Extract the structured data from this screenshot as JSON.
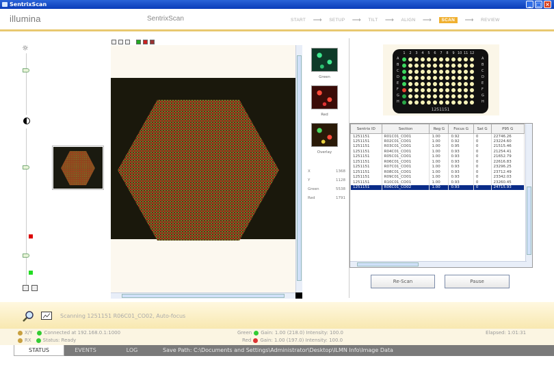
{
  "window": {
    "title": "SentrixScan",
    "min": "_",
    "max": "□",
    "close": "×"
  },
  "header": {
    "logo": "illumina",
    "app_name": "SentrixScan",
    "steps": [
      "START",
      "SETUP",
      "TILT",
      "ALIGN",
      "SCAN",
      "REVIEW"
    ],
    "active_step": "SCAN"
  },
  "colors": {
    "accent": "#f0b030",
    "selection": "#0a2c88",
    "green_led": "#3c3",
    "red_led": "#d33"
  },
  "channels": [
    {
      "label": "Green"
    },
    {
      "label": "Red"
    },
    {
      "label": "Overlay"
    }
  ],
  "readouts": [
    {
      "label": "X",
      "value": "1368"
    },
    {
      "label": "Y",
      "value": "1128"
    },
    {
      "label": "Green",
      "value": "5538"
    },
    {
      "label": "Red",
      "value": "1791"
    }
  ],
  "plate": {
    "rows": [
      "A",
      "B",
      "C",
      "D",
      "E",
      "F",
      "G",
      "H"
    ],
    "cols": [
      "1",
      "2",
      "3",
      "4",
      "5",
      "6",
      "7",
      "8",
      "9",
      "10",
      "11",
      "12"
    ],
    "barcode": "1251151"
  },
  "table": {
    "columns": [
      "Sentrix ID",
      "Section",
      "Reg G",
      "Focus G",
      "Sat G",
      "P95 G"
    ],
    "rows": [
      [
        "1251151",
        "R01C01_CO01",
        "1.00",
        "0.92",
        "0",
        "22746.26"
      ],
      [
        "1251151",
        "R02C01_CO01",
        "1.00",
        "0.92",
        "0",
        "23224.60"
      ],
      [
        "1251151",
        "R03C01_CO01",
        "1.00",
        "0.95",
        "0",
        "21515.46"
      ],
      [
        "1251151",
        "R04C01_CO01",
        "1.00",
        "0.93",
        "0",
        "21254.41"
      ],
      [
        "1251151",
        "R05C01_CO01",
        "1.00",
        "0.93",
        "0",
        "21652.79"
      ],
      [
        "1251151",
        "R06C01_CO01",
        "1.00",
        "0.93",
        "0",
        "22616.83"
      ],
      [
        "1251151",
        "R07C01_CO01",
        "1.00",
        "0.93",
        "0",
        "23296.25"
      ],
      [
        "1251151",
        "R08C01_CO01",
        "1.00",
        "0.93",
        "0",
        "23712.49"
      ],
      [
        "1251151",
        "R09C01_CO01",
        "1.00",
        "0.93",
        "0",
        "23342.03"
      ],
      [
        "1251151",
        "R10C01_CO01",
        "1.00",
        "0.93",
        "0",
        "23260.45"
      ],
      [
        "1251151",
        "R06C01_CO02",
        "1.00",
        "0.93",
        "0",
        "24715.93"
      ]
    ]
  },
  "buttons": {
    "rescan": "Re-Scan",
    "pause": "Pause"
  },
  "status": {
    "message": "Scanning 1251151 R06C01_CO02, Auto-focus"
  },
  "info": {
    "xy_label": "X/Y",
    "xy_value": "Connected at 192.168.0.1:1000",
    "rx_label": "RX",
    "rx_value": "Status: Ready",
    "green_label": "Green",
    "green_value": "Gain: 1.00 (218.0) Intensity: 100.0",
    "red_label": "Red",
    "red_value": "Gain: 1.00 (197.0) Intensity: 100.0",
    "elapsed": "Elapsed: 1:01:31"
  },
  "tabs": [
    "STATUS",
    "EVENTS",
    "LOG"
  ],
  "active_tab": "STATUS",
  "save_path": "Save Path: C:\\Documents and Settings\\Administrator\\Desktop\\ILMN Info\\Image Data"
}
